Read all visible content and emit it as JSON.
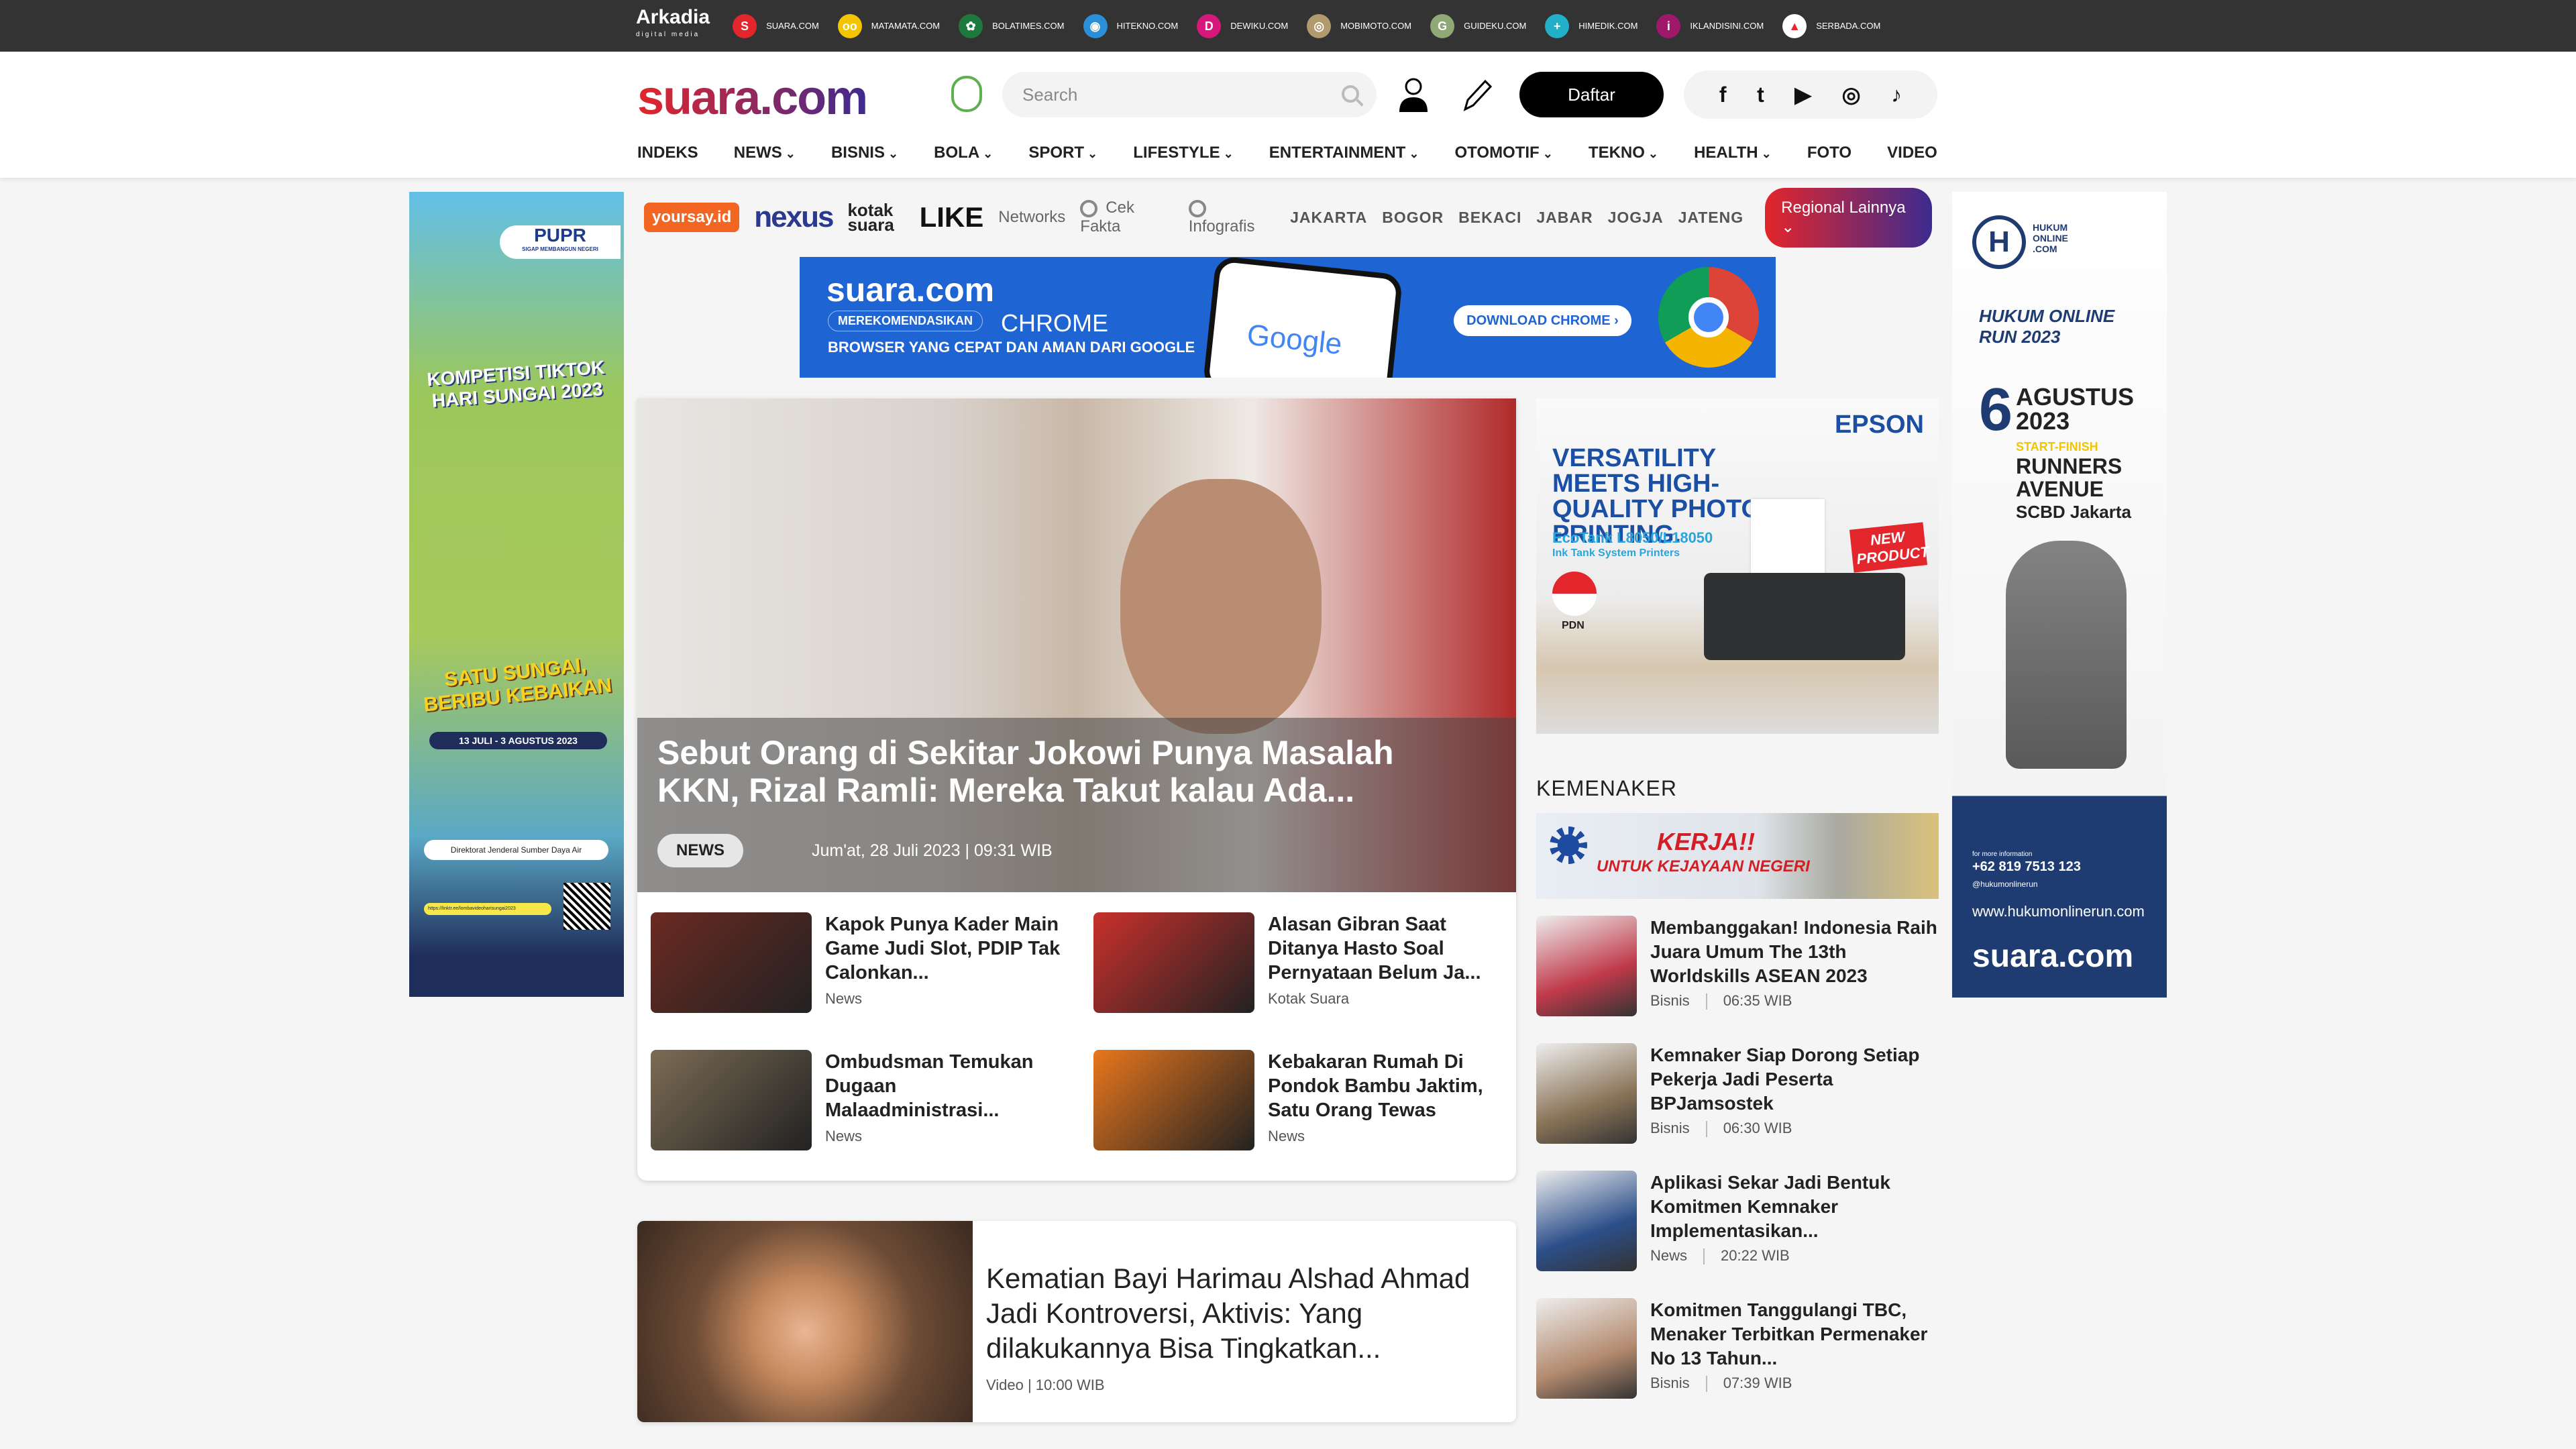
{
  "topbar": {
    "brand": "Arkadia",
    "brand_sub": "digital media",
    "networks": [
      {
        "label": "SUARA.COM",
        "color": "#e3262b",
        "glyph": "S"
      },
      {
        "label": "MATAMATA.COM",
        "color": "#f2c500",
        "glyph": "oo"
      },
      {
        "label": "BOLATIMES.COM",
        "color": "#1e7a3c",
        "glyph": "✿"
      },
      {
        "label": "HITEKNO.COM",
        "color": "#2a8fd6",
        "glyph": "◉"
      },
      {
        "label": "DEWIKU.COM",
        "color": "#d6187a",
        "glyph": "D"
      },
      {
        "label": "MOBIMOTO.COM",
        "color": "#b09a6e",
        "glyph": "◎"
      },
      {
        "label": "GUIDEKU.COM",
        "color": "#8fa876",
        "glyph": "G"
      },
      {
        "label": "HIMEDIK.COM",
        "color": "#21b0c8",
        "glyph": "+"
      },
      {
        "label": "IKLANDISINI.COM",
        "color": "#a0186a",
        "glyph": "i"
      },
      {
        "label": "SERBADA.COM",
        "color": "#ffffff",
        "glyph": "▲"
      }
    ]
  },
  "header": {
    "logo": "suara.com",
    "search_placeholder": "Search",
    "register_label": "Daftar",
    "social": [
      "f",
      "t",
      "▶",
      "◎",
      "♪"
    ]
  },
  "nav": [
    {
      "label": "INDEKS",
      "dd": false
    },
    {
      "label": "NEWS",
      "dd": true
    },
    {
      "label": "BISNIS",
      "dd": true
    },
    {
      "label": "BOLA",
      "dd": true
    },
    {
      "label": "SPORT",
      "dd": true
    },
    {
      "label": "LIFESTYLE",
      "dd": true
    },
    {
      "label": "ENTERTAINMENT",
      "dd": true
    },
    {
      "label": "OTOMOTIF",
      "dd": true
    },
    {
      "label": "TEKNO",
      "dd": true
    },
    {
      "label": "HEALTH",
      "dd": true
    },
    {
      "label": "FOTO",
      "dd": false
    },
    {
      "label": "VIDEO",
      "dd": false
    }
  ],
  "networks_bar": {
    "yoursay": "yoursay.id",
    "nexus": "nexus",
    "kotak": "kotak suara",
    "like": "LIKE",
    "networks": "Networks",
    "cek_fakta": "Cek Fakta",
    "infografis": "Infografis",
    "cities": [
      "JAKARTA",
      "BOGOR",
      "BEKACI",
      "JABAR",
      "JOGJA",
      "JATENG"
    ],
    "regional": "Regional Lainnya"
  },
  "ads": {
    "chrome": {
      "brand": "suara.com",
      "tag": "MEREKOMENDASIKAN",
      "product": "CHROME",
      "tagline": "BROWSER YANG CEPAT DAN AMAN DARI GOOGLE",
      "cta": "DOWNLOAD CHROME ›",
      "google": "Google"
    },
    "left": {
      "brand": "PUPR",
      "sub": "SIGAP MEMBANGUN NEGERI",
      "title1": "KOMPETISI TIKTOK",
      "title2": "HARI SUNGAI 2023",
      "slogan1": "SATU SUNGAI,",
      "slogan2": "BERIBU KEBAIKAN",
      "dates": "13 JULI - 3 AGUSTUS 2023",
      "org": "Direktorat Jenderal Sumber Daya Air",
      "url": "https://linktr.ee/lombavideoharisungai2023"
    },
    "right": {
      "brand": "HUKUM ONLINE .COM",
      "event": "HUKUM ONLINE RUN 2023",
      "day": "6",
      "month": "AGUSTUS",
      "year": "2023",
      "start": "START-FINISH",
      "venue1": "RUNNERS",
      "venue2": "AVENUE",
      "venue3": "SCBD Jakarta",
      "info": "for more information",
      "phone": "+62 819 7513 123",
      "ig": "@hukumonlinerun",
      "site": "www.hukumonlinerun.com",
      "footer": "suara.com"
    },
    "epson": {
      "brand": "EPSON",
      "headline": "VERSATILITY MEETS HIGH-QUALITY PHOTO PRINTING.",
      "model": "EcoTank L8050/L18050",
      "sub": "Ink Tank System Printers",
      "pdn": "PDN",
      "badge": "NEW PRODUCT"
    },
    "kemnaker": {
      "line1": "KERJA!!",
      "line2": "UNTUK KEJAYAAN NEGERI"
    }
  },
  "hero": {
    "title": "Sebut Orang di Sekitar Jokowi Punya Masalah KKN, Rizal Ramli: Mereka Takut kalau Ada...",
    "category": "NEWS",
    "date": "Jum'at, 28 Juli 2023 | 09:31 WIB"
  },
  "grid": [
    {
      "title": "Kapok Punya Kader Main Game Judi Slot, PDIP Tak Calonkan...",
      "category": "News",
      "thumb": "#6b2a22"
    },
    {
      "title": "Alasan Gibran Saat Ditanya Hasto Soal Pernyataan Belum Ja...",
      "category": "Kotak Suara",
      "thumb": "#c9302c"
    },
    {
      "title": "Ombudsman Temukan Dugaan Malaadministrasi...",
      "category": "News",
      "thumb": "#7c6c55"
    },
    {
      "title": "Kebakaran Rumah Di Pondok Bambu Jaktim, Satu Orang Tewas",
      "category": "News",
      "thumb": "#e8771c"
    }
  ],
  "video": {
    "title": "Kematian Bayi Harimau Alshad Ahmad Jadi Kontroversi, Aktivis: Yang dilakukannya Bisa Tingkatkan...",
    "meta": "Video | 10:00 WIB"
  },
  "kemnaker": {
    "heading": "KEMENAKER",
    "items": [
      {
        "title": "Membanggakan! Indonesia Raih Juara Umum The 13th Worldskills ASEAN 2023",
        "category": "Bisnis",
        "time": "06:35 WIB",
        "thumb": "#c03a4a"
      },
      {
        "title": "Kemnaker Siap Dorong Setiap Pekerja Jadi Peserta BPJamsostek",
        "category": "Bisnis",
        "time": "06:30 WIB",
        "thumb": "#8a7458"
      },
      {
        "title": "Aplikasi Sekar Jadi Bentuk Komitmen Kemnaker Implementasikan...",
        "category": "News",
        "time": "20:22 WIB",
        "thumb": "#2c4f8a"
      },
      {
        "title": "Komitmen Tanggulangi TBC, Menaker Terbitkan Permenaker No 13 Tahun...",
        "category": "Bisnis",
        "time": "07:39 WIB",
        "thumb": "#b38a6e"
      }
    ]
  }
}
